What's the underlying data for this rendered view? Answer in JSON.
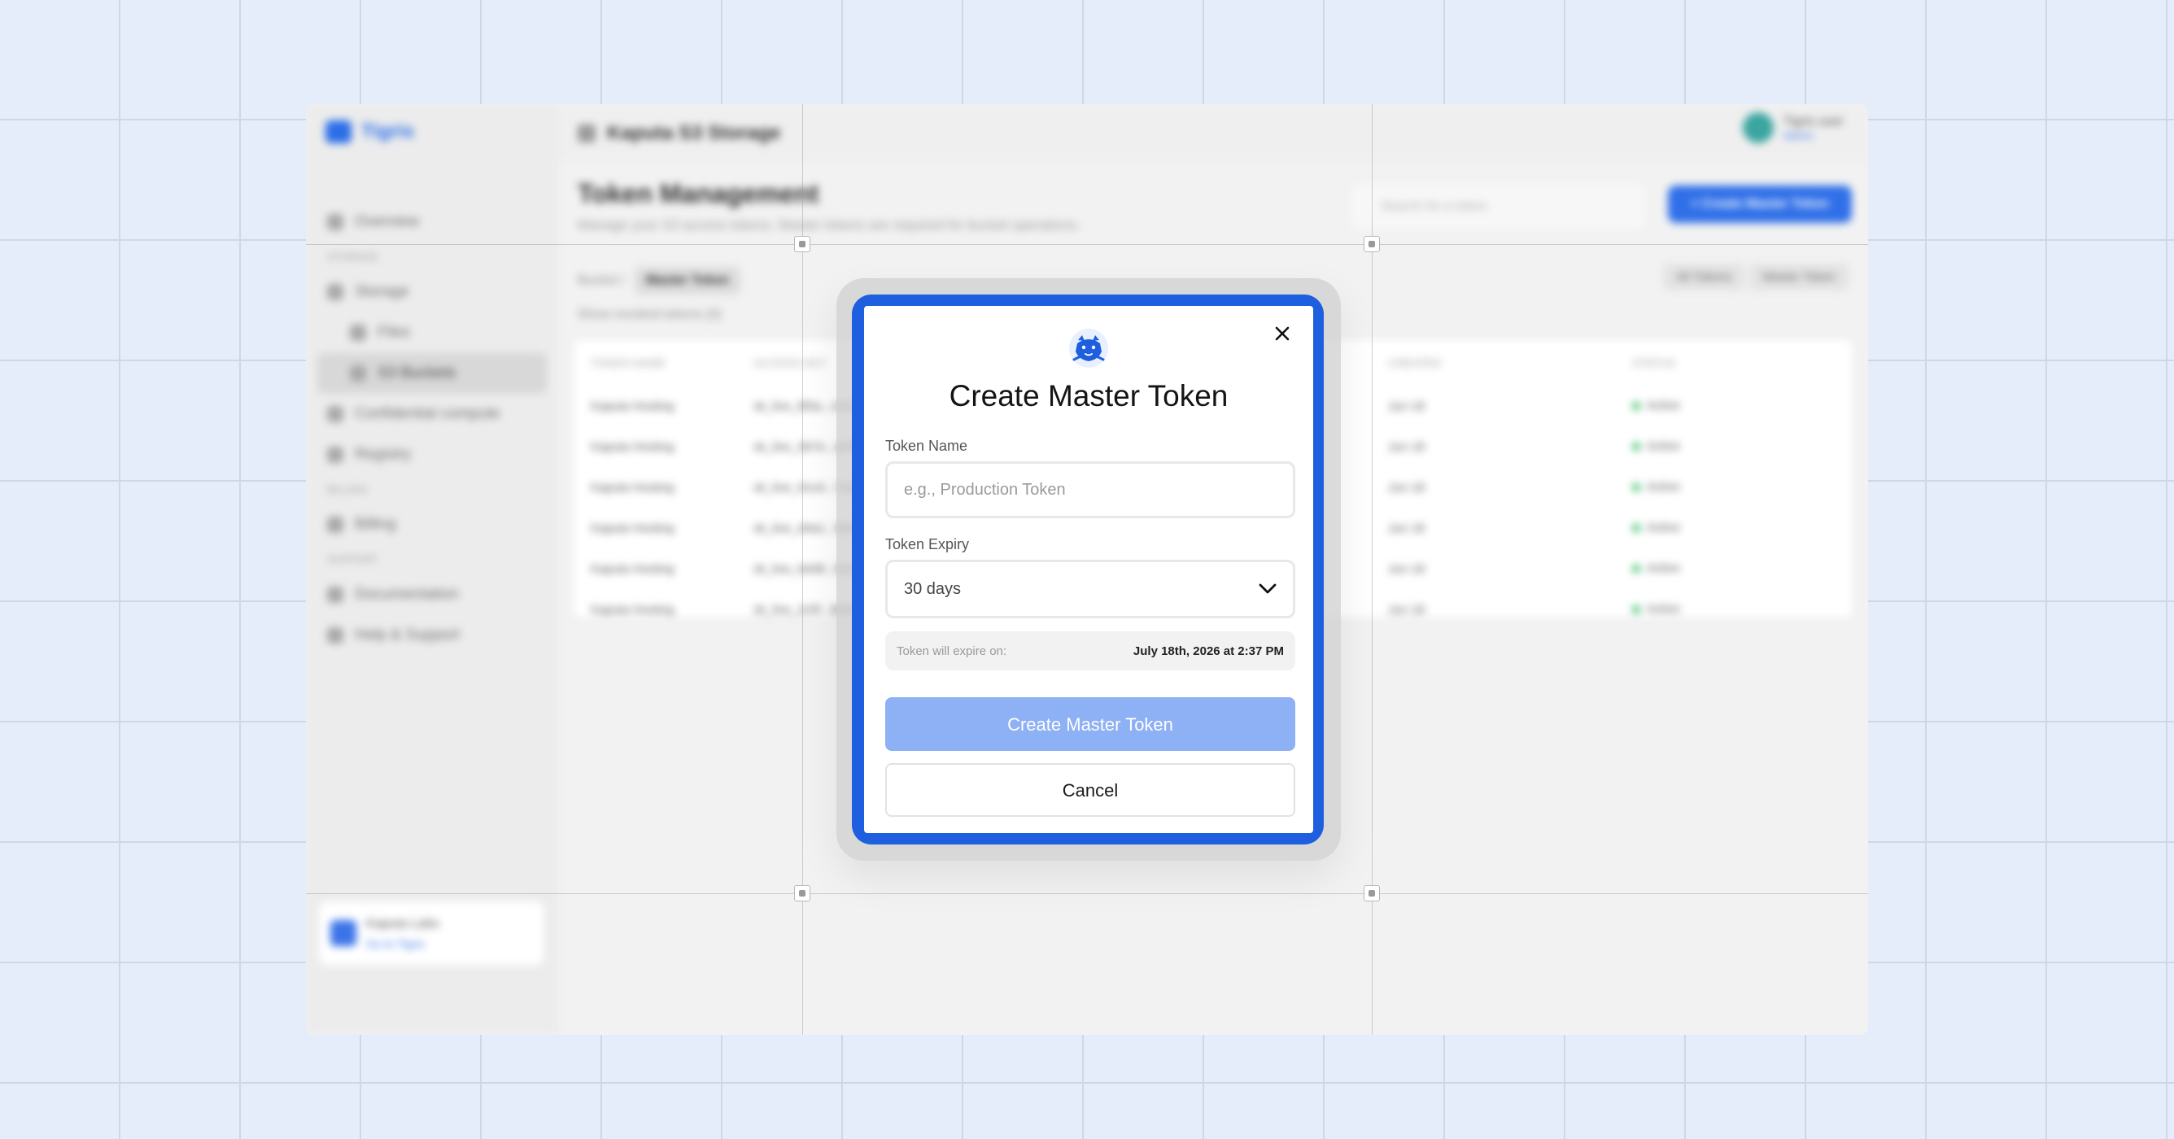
{
  "app": {
    "brand": "Tigris",
    "bucket_title": "Kaputa S3 Storage",
    "user_name": "Tigris user",
    "user_plan": "Admin",
    "page_title": "Token Management",
    "page_subtitle": "Manage your S3 access tokens. Master tokens are required for bucket operations.",
    "search_placeholder": "Search for a token",
    "primary_button": "+ Create Master Token",
    "tab_prefix": "Bucket /",
    "tab_active": "Master Token",
    "checkbox_label": "Show revoked tokens (0)",
    "toggles": [
      "All Tokens",
      "Master Token"
    ],
    "nav": [
      {
        "label": "Overview",
        "type": "item"
      },
      {
        "label": "STORAGE",
        "type": "section"
      },
      {
        "label": "Storage",
        "type": "item"
      },
      {
        "label": "Files",
        "type": "sub"
      },
      {
        "label": "S3 Buckets",
        "type": "sub",
        "active": true
      },
      {
        "label": "Confidential compute",
        "type": "item"
      },
      {
        "label": "Registry",
        "type": "item"
      },
      {
        "label": "BILLING",
        "type": "section"
      },
      {
        "label": "Billing",
        "type": "item"
      },
      {
        "label": "SUPPORT",
        "type": "section"
      },
      {
        "label": "Documentation",
        "type": "item"
      },
      {
        "label": "Help & Support",
        "type": "item"
      }
    ],
    "org_name": "Kaputa Labs",
    "org_link": "Go to Tigris",
    "table": {
      "headers": [
        "TOKEN NAME",
        "ACCESS KEY",
        "CREATED",
        "STATUS"
      ],
      "rows": [
        [
          "Kaputa Hosting",
          "sk_live_8f2a...c91d",
          "Jun 18",
          "Active"
        ],
        [
          "Kaputa Hosting",
          "sk_live_3b7e...a04f",
          "Jun 18",
          "Active"
        ],
        [
          "Kaputa Hosting",
          "sk_live_91cd...7e22",
          "Jun 18",
          "Active"
        ],
        [
          "Kaputa Hosting",
          "sk_live_d4a1...5b63",
          "Jun 18",
          "Active"
        ],
        [
          "Kaputa Hosting",
          "sk_live_6e08...fa19",
          "Jun 18",
          "Active"
        ],
        [
          "Kaputa Hosting",
          "sk_live_2c5f...8d40",
          "Jun 18",
          "Active"
        ]
      ]
    }
  },
  "modal": {
    "title": "Create Master Token",
    "close_icon": "close-icon",
    "logo_icon": "tiger-logo-icon",
    "token_name_label": "Token Name",
    "token_name_placeholder": "e.g., Production Token",
    "token_name_value": "",
    "token_expiry_label": "Token Expiry",
    "token_expiry_value": "30 days",
    "expire_label": "Token will expire on:",
    "expire_date": "July 18th, 2026 at 2:37 PM",
    "create_button": "Create Master Token",
    "cancel_button": "Cancel"
  },
  "colors": {
    "accent": "#1e5fe0",
    "create_button_disabled": "#8eb0f4",
    "background": "#e6edfa"
  }
}
